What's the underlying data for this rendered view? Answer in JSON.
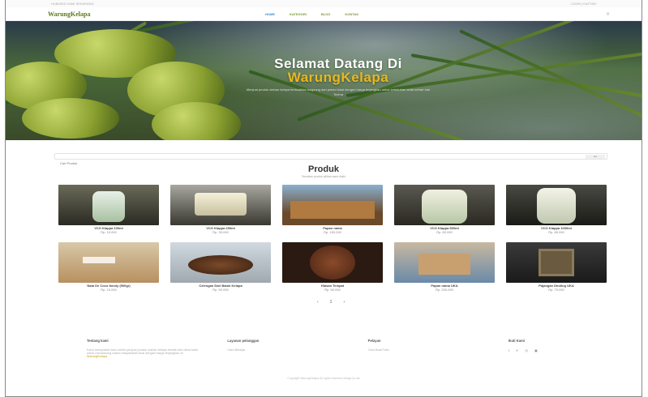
{
  "topbar": {
    "left": "HUBUNGI KAMI SEKARANG",
    "right": "LOGIN | DAFTAR"
  },
  "brand": "WarungKelapa",
  "menu": [
    {
      "label": "HOME",
      "active": true
    },
    {
      "label": "KATEGORI",
      "active": false
    },
    {
      "label": "BLOG",
      "active": false
    },
    {
      "label": "KONTAK",
      "active": false
    }
  ],
  "nav_right": "Q",
  "hero": {
    "title_line1": "Selamat Datang Di",
    "title_line2": "WarungKelapa",
    "subtitle": "Menjual produk olahan kelapa berkualitas langsung dari petani lokal dengan harga terjangkau untuk kebutuhan anda sehari-hari",
    "subtitle2": "Terima"
  },
  "search": {
    "placeholder": "Cari Produk",
    "button": "Go"
  },
  "products_section": {
    "title": "Produk",
    "subtitle": "Temukan produk pilihan kami disini"
  },
  "products": [
    {
      "name": "VCO Klappa 100ml",
      "price": "Rp. 15.000"
    },
    {
      "name": "VCO Klappa 250ml",
      "price": "Rp. 35.000"
    },
    {
      "name": "Papan nama",
      "price": "Rp. 150.000"
    },
    {
      "name": "VCO Klappa 500ml",
      "price": "Rp. 60.000"
    },
    {
      "name": "VCO Klappa 1000ml",
      "price": "Rp. 85.000"
    },
    {
      "name": "Nata De Coco Ibnoly (500gr)",
      "price": "Rp. 15.000"
    },
    {
      "name": "Celengan Dari Batok Kelapa",
      "price": "Rp. 50.000"
    },
    {
      "name": "Hiasan Tempat",
      "price": "Rp. 50.000"
    },
    {
      "name": "Papan nama UKA",
      "price": "Rp. 200.000"
    },
    {
      "name": "Pajangan Dinding UKA",
      "price": "Rp. 75.000"
    }
  ],
  "pager": {
    "prev": "‹",
    "current": "1",
    "next": "›"
  },
  "footer": {
    "col1_title": "Tentang kami",
    "col1_text": "Kami merupakan toko online penjual produk olahan kelapa terbaik dari desa kami untuk mendukung usaha masyarakat lokal dengan harga terjangkau di",
    "col1_link": "WarungKelapa",
    "col2_title": "Layanan pelanggan",
    "col2_text": "Cara Belanja",
    "col3_title": "Pelayan",
    "col3_text": "Cara Buat Toko",
    "col4_title": "Ikuti Kami",
    "social": [
      "f",
      "✔",
      "◎",
      "▣"
    ]
  },
  "copyright": "Copyright WarungKelapa All rights reserved design by aik"
}
